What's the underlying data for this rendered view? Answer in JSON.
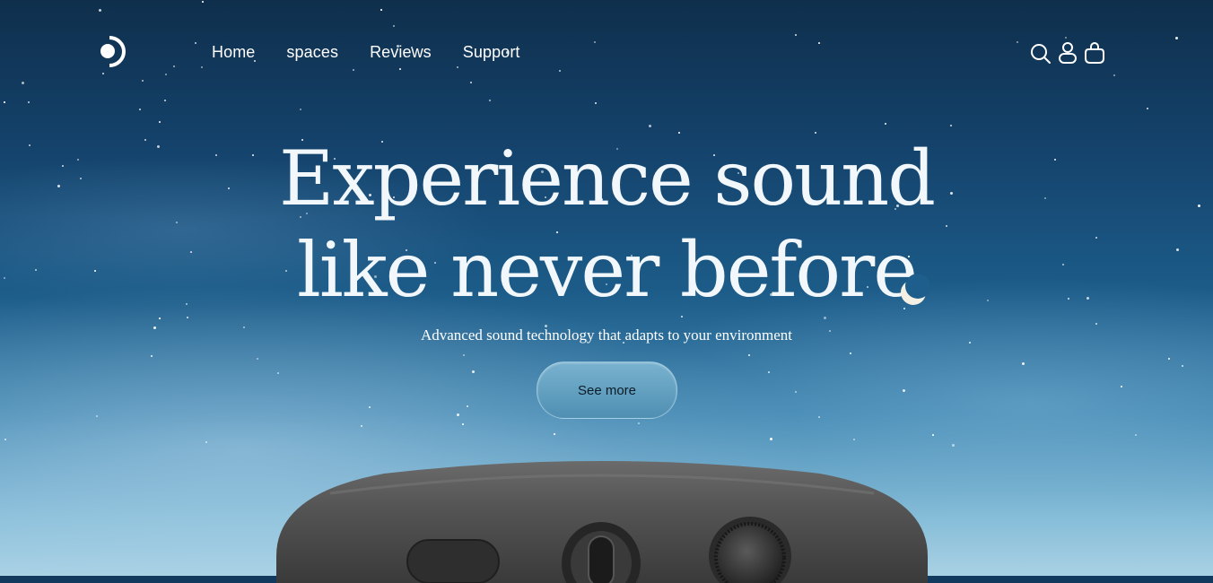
{
  "nav": {
    "logo": "brand-logo",
    "items": [
      {
        "label": "Home"
      },
      {
        "label": "spaces"
      },
      {
        "label": "Reviews"
      },
      {
        "label": "Support"
      }
    ],
    "icons": [
      "search-icon",
      "user-icon",
      "bag-icon"
    ]
  },
  "hero": {
    "title_line1": "Experience sound",
    "title_line2": "like never before",
    "subtitle": "Advanced sound technology that adapts to your environment",
    "cta_label": "See more"
  },
  "colors": {
    "sky_top": "#0f2f4c",
    "sky_bottom": "#a9d1e4",
    "button": "#5e9dbf",
    "text": "#ffffff"
  }
}
